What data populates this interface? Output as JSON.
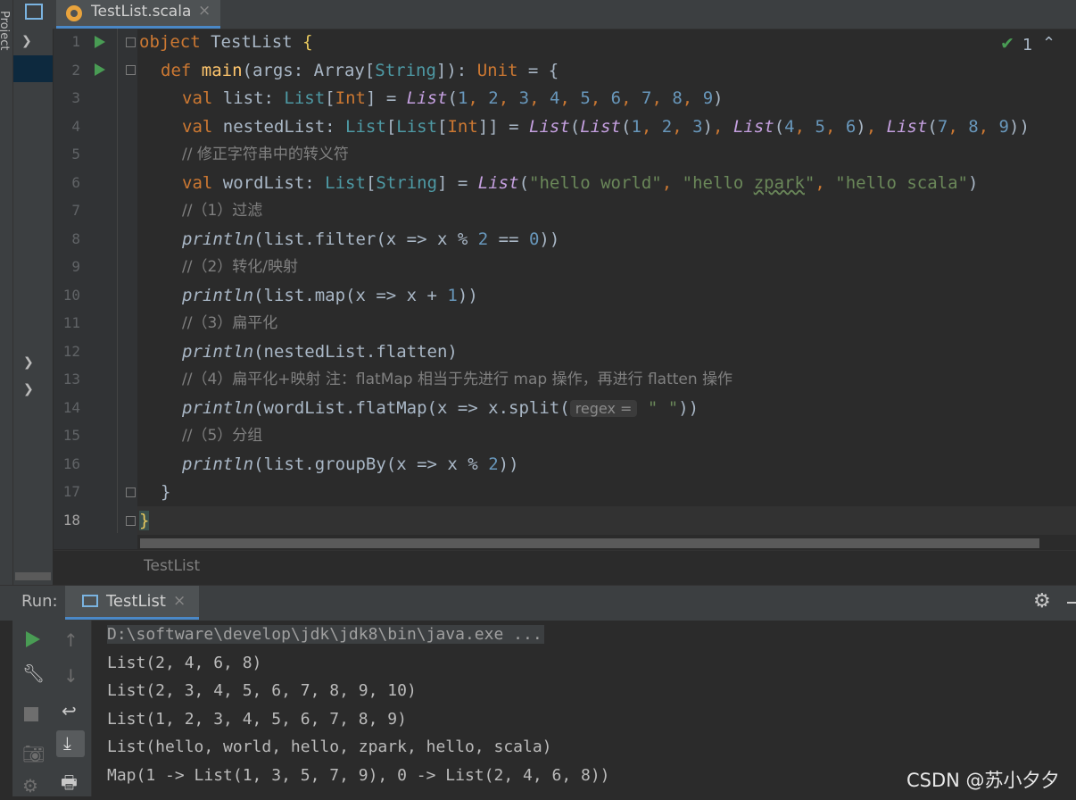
{
  "editor": {
    "tab_title": "TestList.scala",
    "tab_close": "×",
    "inspection_count": "1",
    "breadcrumb": "TestList",
    "line_numbers": [
      "1",
      "2",
      "3",
      "4",
      "5",
      "6",
      "7",
      "8",
      "9",
      "10",
      "11",
      "12",
      "13",
      "14",
      "15",
      "16",
      "17",
      "18"
    ],
    "code": {
      "l1": {
        "kw": "object",
        "name": "TestList",
        "brace": "{"
      },
      "l2": {
        "kw": "def",
        "fn": "main",
        "p1": "(args: ",
        "t1": "Array",
        "p2": "[",
        "t2": "String",
        "p3": "]): ",
        "t3": "Unit",
        "p4": " = {"
      },
      "l3": {
        "kw": "val",
        "name": " list: ",
        "t1": "List",
        "p1": "[",
        "t2": "Int",
        "p2": "] = ",
        "call": "List",
        "open": "(",
        "n": [
          "1",
          "2",
          "3",
          "4",
          "5",
          "6",
          "7",
          "8",
          "9"
        ],
        "close": ")"
      },
      "l4": {
        "kw": "val",
        "name": " nestedList: ",
        "t1": "List",
        "p1": "[",
        "t2": "List",
        "p2": "[",
        "t3": "Int",
        "p3": "]] = ",
        "call": "List",
        "open": "(",
        "inner": "List",
        "n": [
          "1",
          "2",
          "3",
          "4",
          "5",
          "6",
          "7",
          "8",
          "9"
        ],
        "close": ")"
      },
      "l5": "// 修正字符串中的转义符",
      "l6": {
        "kw": "val",
        "name": " wordList: ",
        "t1": "List",
        "p1": "[",
        "t2": "String",
        "p2": "] = ",
        "call": "List",
        "s1": "\"hello world\"",
        "s2a": "\"hello ",
        "s2b": "zpark",
        "s2c": "\"",
        "s3": "\"hello scala\""
      },
      "l7": "//（1）过滤",
      "l8": {
        "call": "println",
        "a": "(list.filter(x => x % ",
        "n1": "2",
        "b": " == ",
        "n2": "0",
        "c": "))"
      },
      "l9": "//（2）转化/映射",
      "l10": {
        "call": "println",
        "a": "(list.map(x => x + ",
        "n1": "1",
        "c": "))"
      },
      "l11": "//（3）扁平化",
      "l12": {
        "call": "println",
        "a": "(nestedList.flatten)"
      },
      "l13": "//（4）扁平化+映射 注：flatMap 相当于先进行 map 操作，再进行 flatten 操作",
      "l14": {
        "call": "println",
        "a": "(wordList.flatMap(x => x.split(",
        "hint": "regex =",
        "s": "\" \"",
        "c": "))"
      },
      "l15": "//（5）分组",
      "l16": {
        "call": "println",
        "a": "(list.groupBy(x => x % ",
        "n1": "2",
        "c": "))"
      },
      "l17": "}",
      "l18": "}"
    }
  },
  "run": {
    "label": "Run:",
    "tab_title": "TestList",
    "tab_close": "×",
    "output": [
      "D:\\software\\develop\\jdk\\jdk8\\bin\\java.exe ...",
      "List(2, 4, 6, 8)",
      "List(2, 3, 4, 5, 6, 7, 8, 9, 10)",
      "List(1, 2, 3, 4, 5, 6, 7, 8, 9)",
      "List(hello, world, hello, zpark, hello, scala)",
      "Map(1 -> List(1, 3, 5, 7, 9), 0 -> List(2, 4, 6, 8))"
    ]
  },
  "sidebar": {
    "project_label": "Project"
  },
  "watermark": "CSDN @苏小夕夕"
}
